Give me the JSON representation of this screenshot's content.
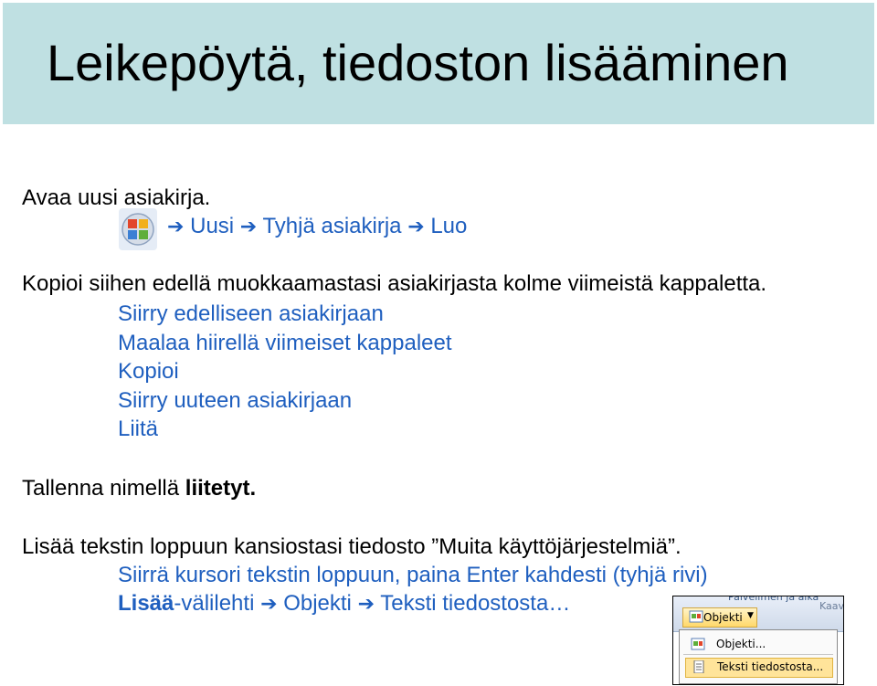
{
  "title": "Leikepöytä, tiedoston lisääminen",
  "step1": {
    "text": "Avaa uusi asiakirja.",
    "menu_path": [
      "Uusi",
      "Tyhjä asiakirja",
      "Luo"
    ],
    "arrow": "➔"
  },
  "step2": {
    "text": "Kopioi siihen edellä muokkaamastasi asiakirjasta kolme viimeistä kappaletta.",
    "substeps": [
      "Siirry edelliseen asiakirjaan",
      "Maalaa hiirellä viimeiset kappaleet",
      "Kopioi",
      "Siirry uuteen asiakirjaan",
      "Liitä"
    ]
  },
  "step3": {
    "prefix": "Tallenna nimellä ",
    "filename": "liitetyt",
    "suffix": "."
  },
  "step4": {
    "text": "Lisää tekstin loppuun kansiostasi tiedosto ”Muita käyttöjärjestelmiä”.",
    "sub1": "Siirrä kursori tekstin loppuun, paina Enter kahdesti (tyhjä rivi)",
    "sub2": {
      "tab_bold": "Lisää",
      "tab_rest": "-välilehti",
      "item1": "Objekti",
      "item2": "Teksti tiedostosta…"
    }
  },
  "screenshot": {
    "ribbon_text": "Palvelimen ja aika",
    "ribbon_text2": "Kaav",
    "button_label": "Objekti",
    "menu_items": [
      "Objekti...",
      "Teksti tiedostosta..."
    ]
  },
  "colors": {
    "title_band": "#bfe0e2",
    "sub_text": "#1f5fbf"
  }
}
